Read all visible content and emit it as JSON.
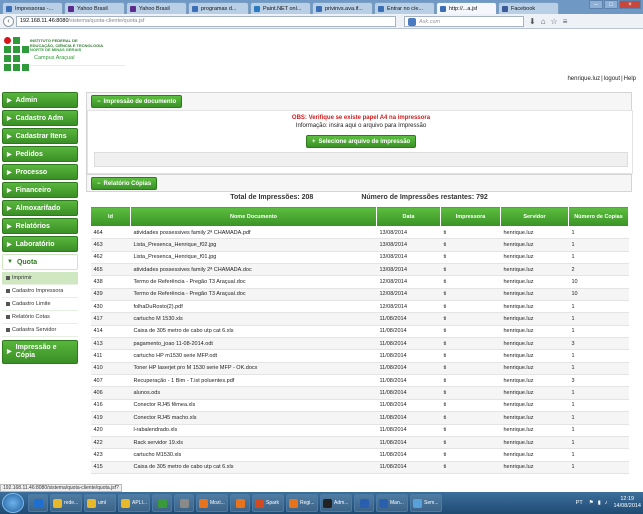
{
  "browser": {
    "tabs": [
      {
        "label": "Impressoras -...",
        "color": "#3b6fb5",
        "icon": "globe-icon"
      },
      {
        "label": "Yahoo Brasil",
        "color": "#5b2b8c",
        "icon": "yahoo-icon"
      },
      {
        "label": "Yahoo Brasil",
        "color": "#5b2b8c",
        "icon": "yahoo-icon"
      },
      {
        "label": "programas d...",
        "color": "#3b6fb5",
        "icon": "globe-icon"
      },
      {
        "label": "Paint.NET onl...",
        "color": "#2a7abf",
        "icon": "paint-icon"
      },
      {
        "label": "privinvs.ava.if...",
        "color": "#3b6fb5",
        "icon": "globe-icon"
      },
      {
        "label": "Entrar no cíe...",
        "color": "#3b6fb5",
        "icon": "zimbra-icon"
      },
      {
        "label": "http://...a.jsf",
        "color": "#3b6fb5",
        "icon": "page-icon",
        "active": true
      },
      {
        "label": "Facebook",
        "color": "#3b5998",
        "icon": "facebook-icon"
      }
    ],
    "url_host": "192.168.11.46:8080",
    "url_path": "/sistema/quota-cliente/quota.jsf",
    "search_placeholder": "Ask.com",
    "status_url": "192.168.11.46:8080/sistema/quota-cliente/quota.jsf?"
  },
  "header": {
    "logo_lines": [
      "INSTITUTO FEDERAL DE",
      "EDUCAÇÃO, CIÊNCIA E TECNOLOGIA",
      "NORTE DE MINAS GERAIS"
    ],
    "logo_sub": "Campus Araçuaí",
    "user": "henrique.luz",
    "logout": "logout",
    "help": "Help"
  },
  "sidebar": {
    "items": [
      {
        "label": "Admin"
      },
      {
        "label": "Cadastro Adm"
      },
      {
        "label": "Cadastrar Itens"
      },
      {
        "label": "Pedidos"
      },
      {
        "label": "Processo"
      },
      {
        "label": "Financeiro"
      },
      {
        "label": "Almoxarifado"
      },
      {
        "label": "Relatórios"
      },
      {
        "label": "Laboratório"
      }
    ],
    "open_item": "Quota",
    "subitems": [
      "Imprimir",
      "Cadastro Impressora",
      "Cadastro Limite",
      "Relatório Cotas",
      "Cadastra Servidor"
    ],
    "last_item": [
      "Impressão e",
      "Cópia"
    ]
  },
  "print_panel": {
    "header_button": "Impressão de documento",
    "obs": "OBS: Verifique se existe papel A4 na impressora",
    "info": "Informação: insira aqui o arquivo para Impressão",
    "select_button": "Selecione arquivo de impressão"
  },
  "report_panel": {
    "header_button": "Relatório Cópias",
    "total_label": "Total de Impressões: 208",
    "remaining_label": "Número de Impressões restantes: 792",
    "columns": [
      "Id",
      "Nome Documento",
      "Data",
      "Impressora",
      "Servidor",
      "Número de Copias"
    ],
    "rows": [
      [
        "464",
        "atividades possessives family 2ª CHAMADA.pdf",
        "13/08/2014",
        "ti",
        "henrique.luz",
        "1"
      ],
      [
        "463",
        "Lista_Presenca_Henrique_f02.jpg",
        "13/08/2014",
        "ti",
        "henrique.luz",
        "1"
      ],
      [
        "462",
        "Lista_Presenca_Henrique_f01.jpg",
        "13/08/2014",
        "ti",
        "henrique.luz",
        "1"
      ],
      [
        "465",
        "atividades possessives family 2ª CHAMADA.doc",
        "13/08/2014",
        "ti",
        "henrique.luz",
        "2"
      ],
      [
        "438",
        "Termo de Referência - Pregão T3 Araçuaí.doc",
        "12/08/2014",
        "ti",
        "henrique.luz",
        "10"
      ],
      [
        "439",
        "Termo de Referência - Pregão T3 Araçuaí.doc",
        "12/08/2014",
        "ti",
        "henrique.luz",
        "10"
      ],
      [
        "430",
        "folhaDuRosto(2).pdf",
        "12/08/2014",
        "ti",
        "henrique.luz",
        "1"
      ],
      [
        "417",
        "cartucho M 1530.xls",
        "11/08/2014",
        "ti",
        "henrique.luz",
        "1"
      ],
      [
        "414",
        "Caixa de 305 metro de cabo utp cat 6.xls",
        "11/08/2014",
        "ti",
        "henrique.luz",
        "1"
      ],
      [
        "413",
        "pagamento_joao 11-08-2014.odt",
        "11/08/2014",
        "ti",
        "henrique.luz",
        "3"
      ],
      [
        "411",
        "cartucho HP m1530 serie MFP.odt",
        "11/08/2014",
        "ti",
        "henrique.luz",
        "1"
      ],
      [
        "410",
        "Toner HP laserjet pro M 1530 serie MFP - OK.docx",
        "11/08/2014",
        "ti",
        "henrique.luz",
        "1"
      ],
      [
        "407",
        "Recuperação - 1 Bim - T.ist poluentes.pdf",
        "11/08/2014",
        "ti",
        "henrique.luz",
        "3"
      ],
      [
        "406",
        "alunos.ods",
        "11/08/2014",
        "ti",
        "henrique.luz",
        "1"
      ],
      [
        "416",
        "Conector RJ45 fêmea.xls",
        "11/08/2014",
        "ti",
        "henrique.luz",
        "1"
      ],
      [
        "419",
        "Conector RJ45 macho.xls",
        "11/08/2014",
        "ti",
        "henrique.luz",
        "1"
      ],
      [
        "420",
        "l-rabalendrado.xls",
        "11/08/2014",
        "ti",
        "henrique.luz",
        "1"
      ],
      [
        "422",
        "Rack servidor 19.xls",
        "11/08/2014",
        "ti",
        "henrique.luz",
        "1"
      ],
      [
        "423",
        "cartucho M1530.xls",
        "11/08/2014",
        "ti",
        "henrique.luz",
        "1"
      ],
      [
        "415",
        "Caixa de 305 metro de cabo utp cat 6.xls",
        "11/08/2014",
        "ti",
        "henrique.luz",
        "1"
      ]
    ]
  },
  "taskbar": {
    "apps": [
      {
        "label": "",
        "color": "#1f6fd1",
        "icon": "ie-icon",
        "pinned": true
      },
      {
        "label": "rede...",
        "color": "#e7b92a",
        "icon": "folder-icon"
      },
      {
        "label": "uml",
        "color": "#e7b92a",
        "icon": "folder-icon"
      },
      {
        "label": "APLI...",
        "color": "#e7b92a",
        "icon": "folder-icon"
      },
      {
        "label": "",
        "color": "#3a9a3a",
        "icon": "chrome-icon",
        "pinned": true
      },
      {
        "label": "",
        "color": "#8a8a8a",
        "icon": "app-icon",
        "pinned": true
      },
      {
        "label": "Mozi...",
        "color": "#e8731d",
        "icon": "firefox-icon"
      },
      {
        "label": "",
        "color": "#e8731d",
        "icon": "app-icon",
        "pinned": true
      },
      {
        "label": "Spark",
        "color": "#d24a1f",
        "icon": "spark-icon"
      },
      {
        "label": "Regi...",
        "color": "#e8731d",
        "icon": "app-icon"
      },
      {
        "label": "Adm...",
        "color": "#222",
        "icon": "cmd-icon"
      },
      {
        "label": "",
        "color": "#2a5fb0",
        "icon": "app-icon",
        "pinned": true
      },
      {
        "label": "Man...",
        "color": "#2a5fb0",
        "icon": "app-icon"
      },
      {
        "label": "Sem...",
        "color": "#5aa0d8",
        "icon": "paint-icon"
      }
    ],
    "lang": "PT",
    "time": "12:19",
    "date": "14/08/2014"
  }
}
